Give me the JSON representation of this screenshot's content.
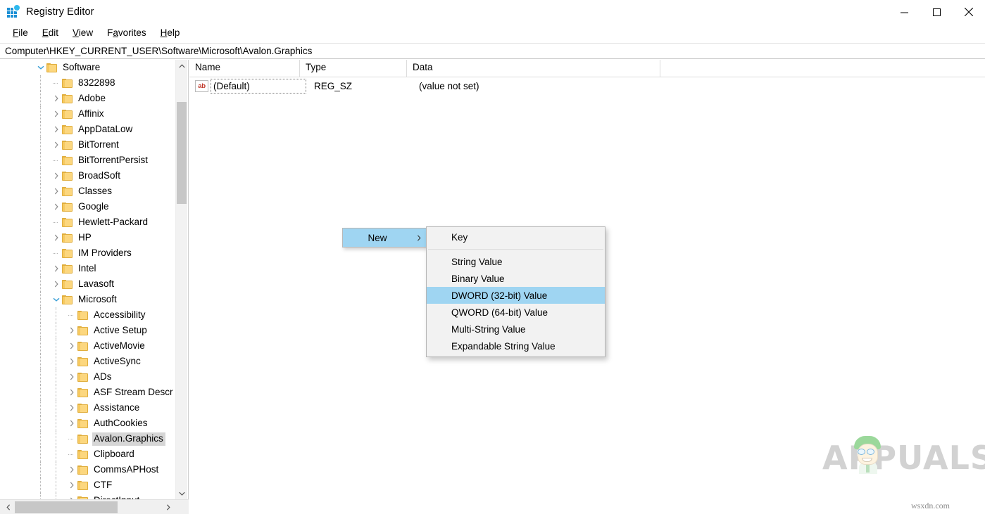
{
  "window": {
    "title": "Registry Editor",
    "icon": "registry-editor-icon",
    "controls": {
      "minimize": "minimize-button",
      "maximize": "maximize-button",
      "close": "close-button"
    }
  },
  "menubar": {
    "items": [
      {
        "label": "File",
        "accel": "F"
      },
      {
        "label": "Edit",
        "accel": "E"
      },
      {
        "label": "View",
        "accel": "V"
      },
      {
        "label": "Favorites",
        "accel": "a"
      },
      {
        "label": "Help",
        "accel": "H"
      }
    ]
  },
  "address": {
    "path": "Computer\\HKEY_CURRENT_USER\\Software\\Microsoft\\Avalon.Graphics"
  },
  "tree": {
    "items": [
      {
        "label": "Software",
        "level": 1,
        "expander": "expanded",
        "selected": false
      },
      {
        "label": "8322898",
        "level": 2,
        "expander": "none",
        "selected": false
      },
      {
        "label": "Adobe",
        "level": 2,
        "expander": "collapsed",
        "selected": false
      },
      {
        "label": "Affinix",
        "level": 2,
        "expander": "collapsed",
        "selected": false
      },
      {
        "label": "AppDataLow",
        "level": 2,
        "expander": "collapsed",
        "selected": false
      },
      {
        "label": "BitTorrent",
        "level": 2,
        "expander": "collapsed",
        "selected": false
      },
      {
        "label": "BitTorrentPersist",
        "level": 2,
        "expander": "none",
        "selected": false
      },
      {
        "label": "BroadSoft",
        "level": 2,
        "expander": "collapsed",
        "selected": false
      },
      {
        "label": "Classes",
        "level": 2,
        "expander": "collapsed",
        "selected": false
      },
      {
        "label": "Google",
        "level": 2,
        "expander": "collapsed",
        "selected": false
      },
      {
        "label": "Hewlett-Packard",
        "level": 2,
        "expander": "none",
        "selected": false
      },
      {
        "label": "HP",
        "level": 2,
        "expander": "collapsed",
        "selected": false
      },
      {
        "label": "IM Providers",
        "level": 2,
        "expander": "none",
        "selected": false
      },
      {
        "label": "Intel",
        "level": 2,
        "expander": "collapsed",
        "selected": false
      },
      {
        "label": "Lavasoft",
        "level": 2,
        "expander": "collapsed",
        "selected": false
      },
      {
        "label": "Microsoft",
        "level": 2,
        "expander": "expanded",
        "selected": false
      },
      {
        "label": "Accessibility",
        "level": 3,
        "expander": "none",
        "selected": false
      },
      {
        "label": "Active Setup",
        "level": 3,
        "expander": "collapsed",
        "selected": false
      },
      {
        "label": "ActiveMovie",
        "level": 3,
        "expander": "collapsed",
        "selected": false
      },
      {
        "label": "ActiveSync",
        "level": 3,
        "expander": "collapsed",
        "selected": false
      },
      {
        "label": "ADs",
        "level": 3,
        "expander": "collapsed",
        "selected": false
      },
      {
        "label": "ASF Stream Descr",
        "level": 3,
        "expander": "collapsed",
        "selected": false
      },
      {
        "label": "Assistance",
        "level": 3,
        "expander": "collapsed",
        "selected": false
      },
      {
        "label": "AuthCookies",
        "level": 3,
        "expander": "collapsed",
        "selected": false
      },
      {
        "label": "Avalon.Graphics",
        "level": 3,
        "expander": "none",
        "selected": true
      },
      {
        "label": "Clipboard",
        "level": 3,
        "expander": "none",
        "selected": false
      },
      {
        "label": "CommsAPHost",
        "level": 3,
        "expander": "collapsed",
        "selected": false
      },
      {
        "label": "CTF",
        "level": 3,
        "expander": "collapsed",
        "selected": false
      },
      {
        "label": "DirectInput",
        "level": 3,
        "expander": "collapsed",
        "selected": false
      }
    ]
  },
  "list": {
    "columns": [
      "Name",
      "Type",
      "Data"
    ],
    "rows": [
      {
        "name": "(Default)",
        "type": "REG_SZ",
        "data": "(value not set)",
        "icon": "string-value-icon"
      }
    ]
  },
  "context_menu": {
    "parent": {
      "label": "New",
      "submenu_arrow": "chevron-right-icon"
    },
    "items": [
      {
        "label": "Key",
        "highlighted": false,
        "separator_after": true
      },
      {
        "label": "String Value",
        "highlighted": false,
        "separator_after": false
      },
      {
        "label": "Binary Value",
        "highlighted": false,
        "separator_after": false
      },
      {
        "label": "DWORD (32-bit) Value",
        "highlighted": true,
        "separator_after": false
      },
      {
        "label": "QWORD (64-bit) Value",
        "highlighted": false,
        "separator_after": false
      },
      {
        "label": "Multi-String Value",
        "highlighted": false,
        "separator_after": false
      },
      {
        "label": "Expandable String Value",
        "highlighted": false,
        "separator_after": false
      }
    ]
  },
  "watermark": {
    "brand": "APPUALS",
    "site": "wsxdn.com"
  },
  "colors": {
    "highlight_blue": "#9fd5f2",
    "selection_gray": "#d6d6d6",
    "folder_yellow": "#fcd77f",
    "accent_icon_blue": "#1b8fd4"
  }
}
